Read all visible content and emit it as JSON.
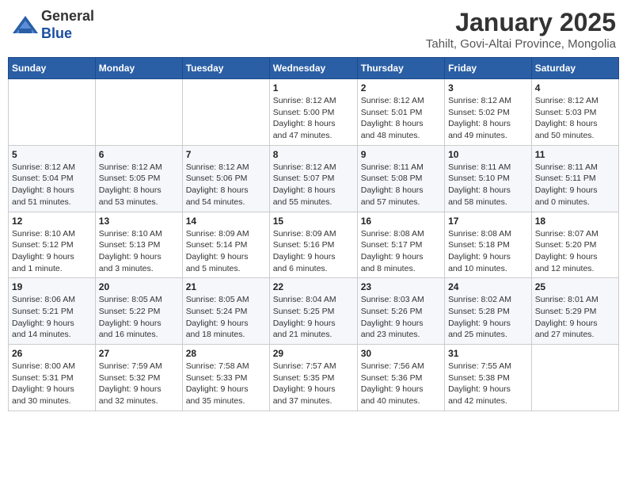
{
  "header": {
    "logo_line1": "General",
    "logo_line2": "Blue",
    "month_title": "January 2025",
    "location": "Tahilt, Govi-Altai Province, Mongolia"
  },
  "weekdays": [
    "Sunday",
    "Monday",
    "Tuesday",
    "Wednesday",
    "Thursday",
    "Friday",
    "Saturday"
  ],
  "weeks": [
    [
      {
        "day": "",
        "info": ""
      },
      {
        "day": "",
        "info": ""
      },
      {
        "day": "",
        "info": ""
      },
      {
        "day": "1",
        "info": "Sunrise: 8:12 AM\nSunset: 5:00 PM\nDaylight: 8 hours\nand 47 minutes."
      },
      {
        "day": "2",
        "info": "Sunrise: 8:12 AM\nSunset: 5:01 PM\nDaylight: 8 hours\nand 48 minutes."
      },
      {
        "day": "3",
        "info": "Sunrise: 8:12 AM\nSunset: 5:02 PM\nDaylight: 8 hours\nand 49 minutes."
      },
      {
        "day": "4",
        "info": "Sunrise: 8:12 AM\nSunset: 5:03 PM\nDaylight: 8 hours\nand 50 minutes."
      }
    ],
    [
      {
        "day": "5",
        "info": "Sunrise: 8:12 AM\nSunset: 5:04 PM\nDaylight: 8 hours\nand 51 minutes."
      },
      {
        "day": "6",
        "info": "Sunrise: 8:12 AM\nSunset: 5:05 PM\nDaylight: 8 hours\nand 53 minutes."
      },
      {
        "day": "7",
        "info": "Sunrise: 8:12 AM\nSunset: 5:06 PM\nDaylight: 8 hours\nand 54 minutes."
      },
      {
        "day": "8",
        "info": "Sunrise: 8:12 AM\nSunset: 5:07 PM\nDaylight: 8 hours\nand 55 minutes."
      },
      {
        "day": "9",
        "info": "Sunrise: 8:11 AM\nSunset: 5:08 PM\nDaylight: 8 hours\nand 57 minutes."
      },
      {
        "day": "10",
        "info": "Sunrise: 8:11 AM\nSunset: 5:10 PM\nDaylight: 8 hours\nand 58 minutes."
      },
      {
        "day": "11",
        "info": "Sunrise: 8:11 AM\nSunset: 5:11 PM\nDaylight: 9 hours\nand 0 minutes."
      }
    ],
    [
      {
        "day": "12",
        "info": "Sunrise: 8:10 AM\nSunset: 5:12 PM\nDaylight: 9 hours\nand 1 minute."
      },
      {
        "day": "13",
        "info": "Sunrise: 8:10 AM\nSunset: 5:13 PM\nDaylight: 9 hours\nand 3 minutes."
      },
      {
        "day": "14",
        "info": "Sunrise: 8:09 AM\nSunset: 5:14 PM\nDaylight: 9 hours\nand 5 minutes."
      },
      {
        "day": "15",
        "info": "Sunrise: 8:09 AM\nSunset: 5:16 PM\nDaylight: 9 hours\nand 6 minutes."
      },
      {
        "day": "16",
        "info": "Sunrise: 8:08 AM\nSunset: 5:17 PM\nDaylight: 9 hours\nand 8 minutes."
      },
      {
        "day": "17",
        "info": "Sunrise: 8:08 AM\nSunset: 5:18 PM\nDaylight: 9 hours\nand 10 minutes."
      },
      {
        "day": "18",
        "info": "Sunrise: 8:07 AM\nSunset: 5:20 PM\nDaylight: 9 hours\nand 12 minutes."
      }
    ],
    [
      {
        "day": "19",
        "info": "Sunrise: 8:06 AM\nSunset: 5:21 PM\nDaylight: 9 hours\nand 14 minutes."
      },
      {
        "day": "20",
        "info": "Sunrise: 8:05 AM\nSunset: 5:22 PM\nDaylight: 9 hours\nand 16 minutes."
      },
      {
        "day": "21",
        "info": "Sunrise: 8:05 AM\nSunset: 5:24 PM\nDaylight: 9 hours\nand 18 minutes."
      },
      {
        "day": "22",
        "info": "Sunrise: 8:04 AM\nSunset: 5:25 PM\nDaylight: 9 hours\nand 21 minutes."
      },
      {
        "day": "23",
        "info": "Sunrise: 8:03 AM\nSunset: 5:26 PM\nDaylight: 9 hours\nand 23 minutes."
      },
      {
        "day": "24",
        "info": "Sunrise: 8:02 AM\nSunset: 5:28 PM\nDaylight: 9 hours\nand 25 minutes."
      },
      {
        "day": "25",
        "info": "Sunrise: 8:01 AM\nSunset: 5:29 PM\nDaylight: 9 hours\nand 27 minutes."
      }
    ],
    [
      {
        "day": "26",
        "info": "Sunrise: 8:00 AM\nSunset: 5:31 PM\nDaylight: 9 hours\nand 30 minutes."
      },
      {
        "day": "27",
        "info": "Sunrise: 7:59 AM\nSunset: 5:32 PM\nDaylight: 9 hours\nand 32 minutes."
      },
      {
        "day": "28",
        "info": "Sunrise: 7:58 AM\nSunset: 5:33 PM\nDaylight: 9 hours\nand 35 minutes."
      },
      {
        "day": "29",
        "info": "Sunrise: 7:57 AM\nSunset: 5:35 PM\nDaylight: 9 hours\nand 37 minutes."
      },
      {
        "day": "30",
        "info": "Sunrise: 7:56 AM\nSunset: 5:36 PM\nDaylight: 9 hours\nand 40 minutes."
      },
      {
        "day": "31",
        "info": "Sunrise: 7:55 AM\nSunset: 5:38 PM\nDaylight: 9 hours\nand 42 minutes."
      },
      {
        "day": "",
        "info": ""
      }
    ]
  ]
}
